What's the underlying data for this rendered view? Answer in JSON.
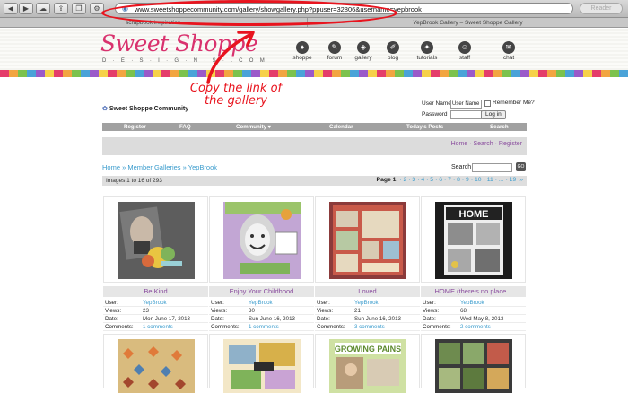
{
  "browser": {
    "url": "www.sweetshoppecommunity.com/gallery/showgallery.php?ppuser=32806&username=yepbrook",
    "reader_label": "Reader",
    "tabs": [
      {
        "label": "scrapbook inspiration"
      },
      {
        "label": "YepBrook Gallery – Sweet Shoppe Gallery"
      }
    ]
  },
  "site": {
    "logo_title": "Sweet Shoppe",
    "logo_sub": "D·E·S·I·G·N·S·.COM",
    "nav": [
      {
        "label": "shoppe",
        "icon": "shop-icon"
      },
      {
        "label": "forum",
        "icon": "forum-icon"
      },
      {
        "label": "gallery",
        "icon": "gallery-icon"
      },
      {
        "label": "blog",
        "icon": "blog-icon"
      },
      {
        "label": "tutorials",
        "icon": "tutorials-icon"
      },
      {
        "label": "staff",
        "icon": "staff-icon"
      },
      {
        "label": "chat",
        "icon": "chat-icon"
      }
    ]
  },
  "annotation": {
    "text": "Copy the link of the gallery",
    "color": "#e8141e"
  },
  "forum": {
    "title": "Sweet Shoppe Community",
    "login": {
      "username_label": "User Name",
      "username_value": "User Name",
      "password_label": "Password",
      "remember_label": "Remember Me?",
      "login_button": "Log in"
    },
    "nav": [
      "Register",
      "FAQ",
      "Community ▾",
      "Calendar",
      "Today's Posts",
      "Search"
    ],
    "links": {
      "home": "Home",
      "search": "Search",
      "register": "Register"
    }
  },
  "gallery": {
    "breadcrumb": {
      "home": "Home",
      "member_galleries": "Member Galleries",
      "user": "YepBrook"
    },
    "search_label": "Search",
    "count_text": "Images 1 to 16 of 293",
    "pagination": {
      "label": "Page",
      "current": "1",
      "pages": [
        "2",
        "3",
        "4",
        "5",
        "6",
        "7",
        "8",
        "9",
        "10",
        "11",
        "...",
        "19"
      ],
      "next": "»"
    },
    "meta_labels": {
      "user": "User:",
      "views": "Views:",
      "date": "Date:",
      "comments": "Comments:"
    },
    "items": [
      {
        "title": "Be Kind",
        "user": "YepBrook",
        "views": "23",
        "date": "Mon June 17, 2013",
        "comments": "1 comments"
      },
      {
        "title": "Enjoy Your Childhood",
        "user": "YepBrook",
        "views": "30",
        "date": "Sun June 16, 2013",
        "comments": "1 comments"
      },
      {
        "title": "Loved",
        "user": "YepBrook",
        "views": "21",
        "date": "Sun June 16, 2013",
        "comments": "3 comments"
      },
      {
        "title": "HOME (there's no place...",
        "user": "YepBrook",
        "views": "68",
        "date": "Wed May 8, 2013",
        "comments": "2 comments"
      }
    ],
    "row2_texts": {
      "item3_caption": "GROWING PAINS"
    }
  },
  "colors": {
    "brand_pink": "#d9326e",
    "link_blue": "#3b9ccd",
    "title_purple": "#8a4d9e",
    "annotation_red": "#e8141e"
  }
}
